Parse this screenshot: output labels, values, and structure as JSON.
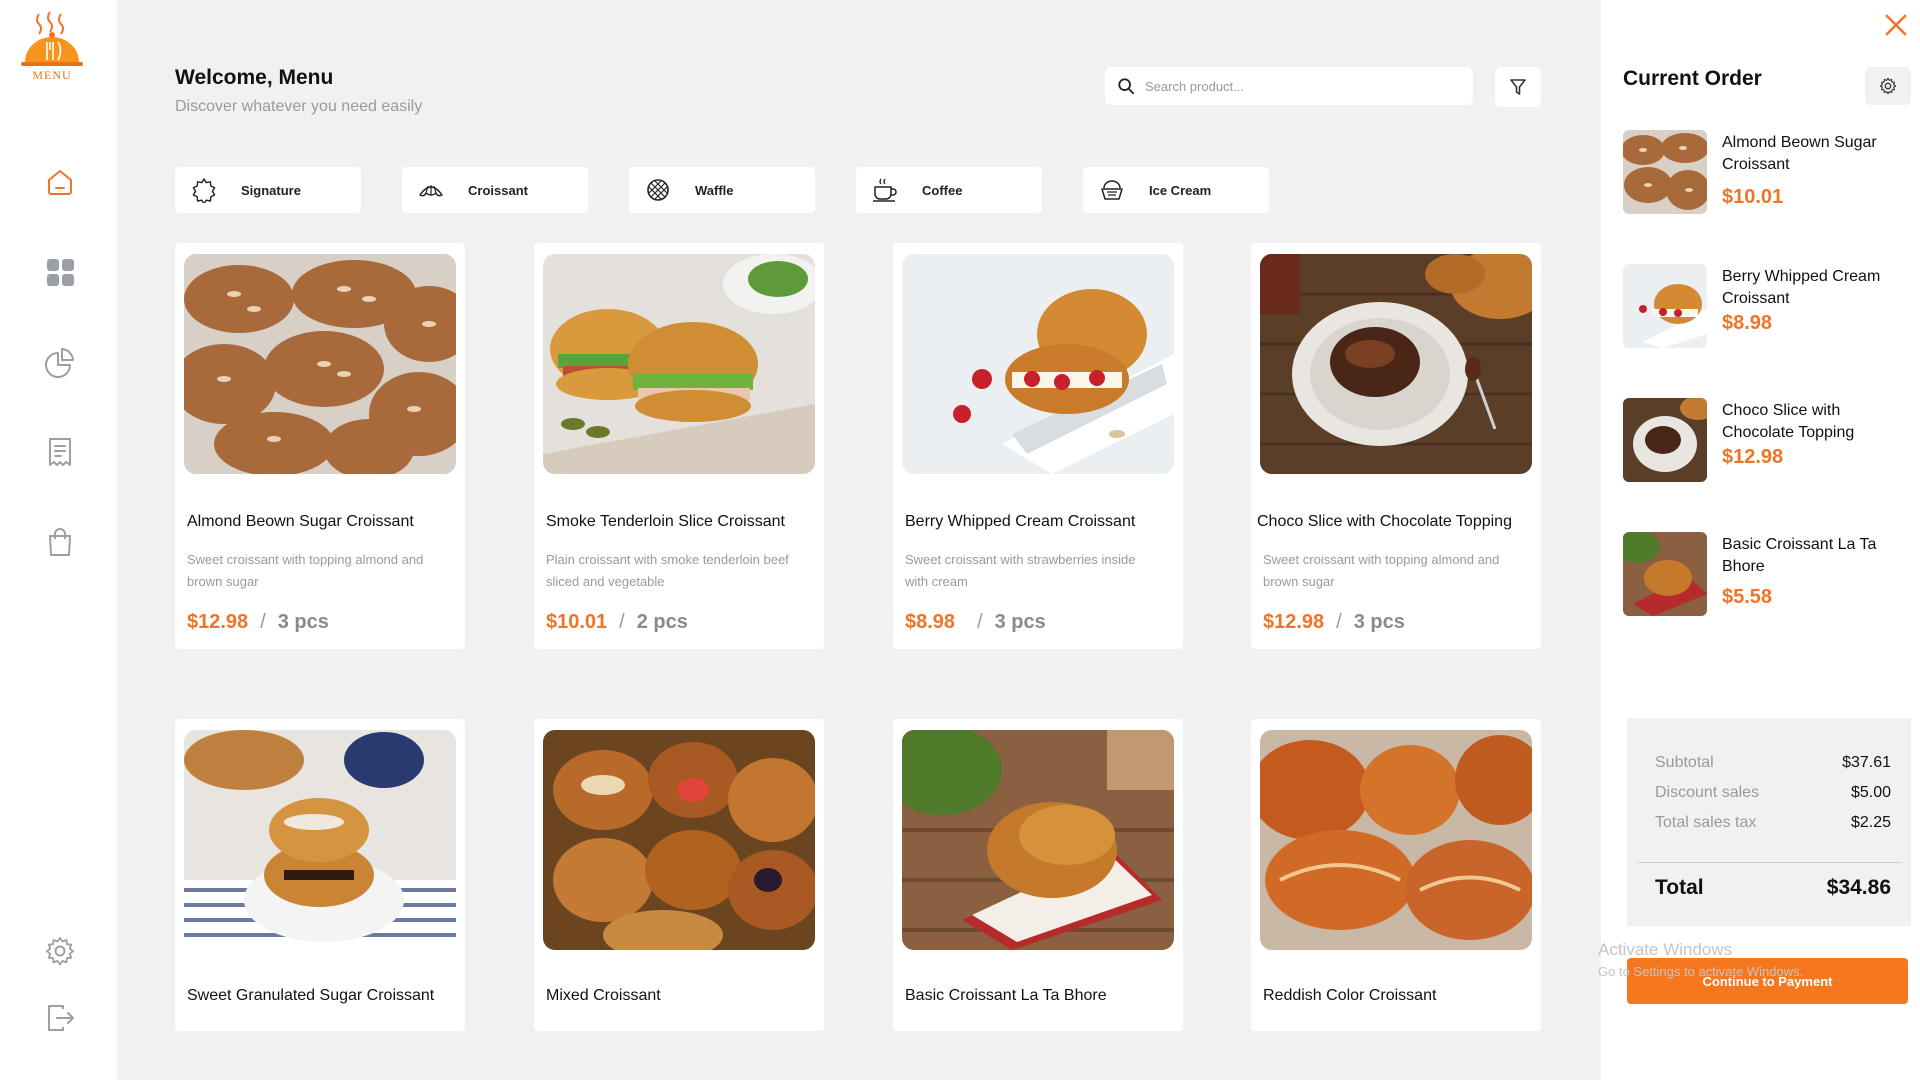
{
  "brand": {
    "logo_text": "MENU",
    "accent": "#f07426"
  },
  "sidebar": {
    "items": [
      {
        "name": "home-icon"
      },
      {
        "name": "dashboard-icon"
      },
      {
        "name": "pie-chart-icon"
      },
      {
        "name": "receipt-icon"
      },
      {
        "name": "shopping-bag-icon"
      },
      {
        "name": "settings-icon"
      },
      {
        "name": "logout-icon"
      }
    ]
  },
  "header": {
    "title": "Welcome, Menu",
    "subtitle": "Discover whatever you need easily",
    "search_placeholder": "Search product..."
  },
  "categories": [
    {
      "label": "Signature",
      "icon": "signature-icon"
    },
    {
      "label": "Croissant",
      "icon": "croissant-icon"
    },
    {
      "label": "Waffle",
      "icon": "waffle-icon"
    },
    {
      "label": "Coffee",
      "icon": "coffee-icon"
    },
    {
      "label": "Ice Cream",
      "icon": "ice-cream-icon"
    }
  ],
  "products": [
    {
      "name": "Almond Beown Sugar Croissant",
      "desc": "Sweet croissant with topping almond and brown sugar",
      "price": "$12.98",
      "sep": "/",
      "qty": "3 pcs"
    },
    {
      "name": "Smoke Tenderloin Slice Croissant",
      "desc": "Plain croissant with smoke tenderloin beef sliced and vegetable",
      "price": "$10.01",
      "sep": "/",
      "qty": "2 pcs"
    },
    {
      "name": "Berry Whipped Cream Croissant",
      "desc": "Sweet croissant with strawberries inside with cream",
      "price": "$8.98",
      "sep": "/",
      "qty": "3 pcs"
    },
    {
      "name": "Choco Slice with Chocolate Topping",
      "desc": "Sweet croissant with topping almond and brown sugar",
      "price": "$12.98",
      "sep": "/",
      "qty": "3 pcs"
    },
    {
      "name": "Sweet Granulated Sugar Croissant"
    },
    {
      "name": "Mixed Croissant"
    },
    {
      "name": "Basic Croissant La Ta Bhore"
    },
    {
      "name": "Reddish Color Croissant"
    }
  ],
  "order": {
    "title": "Current Order",
    "items": [
      {
        "name": "Almond Beown Sugar Croissant",
        "price": "$10.01"
      },
      {
        "name": "Berry Whipped Cream Croissant",
        "price": "$8.98"
      },
      {
        "name": "Choco Slice with Chocolate Topping",
        "price": "$12.98"
      },
      {
        "name": "Basic Croissant La Ta Bhore",
        "price": "$5.58"
      }
    ],
    "summary": {
      "subtotal_label": "Subtotal",
      "subtotal": "$37.61",
      "discount_label": "Discount sales",
      "discount": "$5.00",
      "tax_label": "Total sales tax",
      "tax": "$2.25",
      "total_label": "Total",
      "total": "$34.86"
    },
    "pay_label": "Continue to Payment"
  },
  "watermark": {
    "line1": "Activate Windows",
    "line2": "Go to Settings to activate Windows."
  }
}
